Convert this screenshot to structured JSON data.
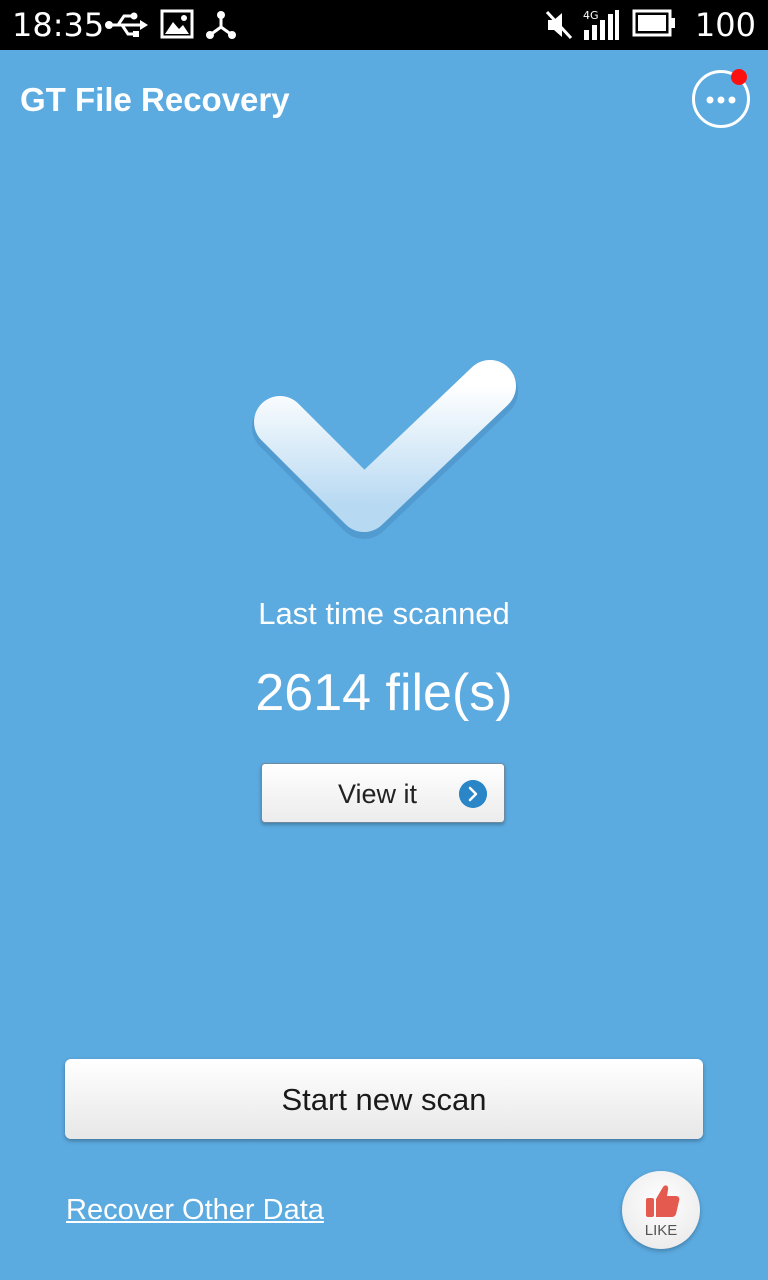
{
  "status_bar": {
    "time": "18:35",
    "left_icons": [
      "usb-icon",
      "image-icon",
      "share-network-icon"
    ],
    "right_icons": [
      "mute-icon",
      "4g-signal-icon",
      "battery-icon"
    ],
    "network_label": "4G",
    "battery_level": "100"
  },
  "header": {
    "title": "GT File Recovery",
    "menu_icon": "more-horizontal-icon"
  },
  "main": {
    "check_icon": "checkmark-icon",
    "last_scanned_label": "Last time scanned",
    "file_count": "2614 file(s)",
    "view_button_label": "View it",
    "view_button_icon": "chevron-right-icon"
  },
  "footer": {
    "scan_button_label": "Start new scan",
    "recover_link_text": "Recover Other Data",
    "like_label": "LIKE",
    "like_icon": "thumbs-up-icon"
  },
  "colors": {
    "background": "#5BAAE0",
    "status_bar": "#000000",
    "accent_blue": "#2A86C6",
    "notification_red": "#FF1010",
    "like_red": "#E55A4E"
  }
}
